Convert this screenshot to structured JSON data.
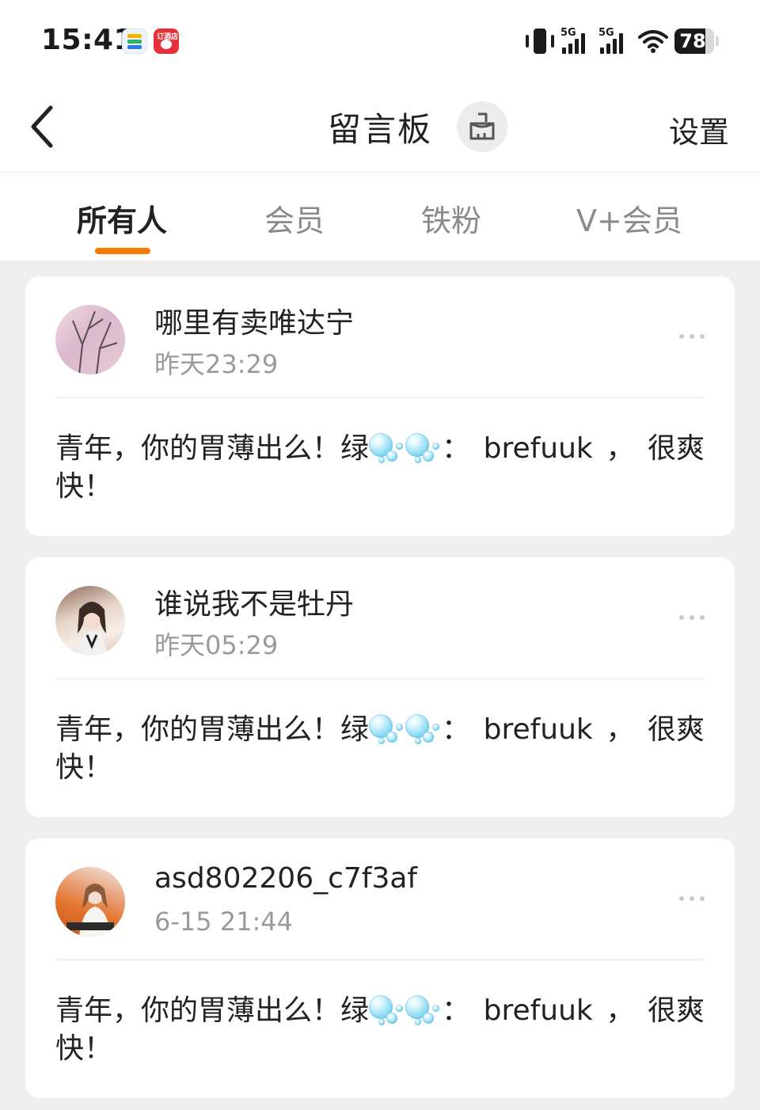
{
  "status_bar": {
    "time": "15:41",
    "app_icons": [
      "wallet-icon",
      "shop-app-icon"
    ],
    "shop_icon_text": "订酒店",
    "signal_1_label": "5G",
    "signal_2_label": "5G",
    "battery_level": "78",
    "battery_fraction": 0.78
  },
  "nav": {
    "title": "留言板",
    "settings_label": "设置"
  },
  "tabs": [
    {
      "label": "所有人",
      "active": true
    },
    {
      "label": "会员",
      "active": false
    },
    {
      "label": "铁粉",
      "active": false
    },
    {
      "label": "V+会员",
      "active": false
    }
  ],
  "colors": {
    "accent": "#f57c00",
    "background": "#efefef",
    "card": "#ffffff",
    "secondary_text": "#9a9a9a"
  },
  "messages": [
    {
      "username": "哪里有卖唯达宁",
      "time": "昨天23:29",
      "text_before": "青年，你的胃薄出么！绿",
      "text_after": "：",
      "text_english": "brefuuk",
      "text_comma": "，",
      "text_end": "很爽",
      "text_line2": "快！",
      "emoji": "bubble-emoji"
    },
    {
      "username": "谁说我不是牡丹",
      "time": "昨天05:29",
      "text_before": "青年，你的胃薄出么！绿",
      "text_after": "：",
      "text_english": "brefuuk",
      "text_comma": "，",
      "text_end": "很爽",
      "text_line2": "快！",
      "emoji": "bubble-emoji"
    },
    {
      "username": "asd802206_c7f3af",
      "time": "6-15 21:44",
      "text_before": "青年，你的胃薄出么！绿",
      "text_after": "：",
      "text_english": "brefuuk",
      "text_comma": "，",
      "text_end": "很爽",
      "text_line2": "快！",
      "emoji": "bubble-emoji"
    }
  ]
}
